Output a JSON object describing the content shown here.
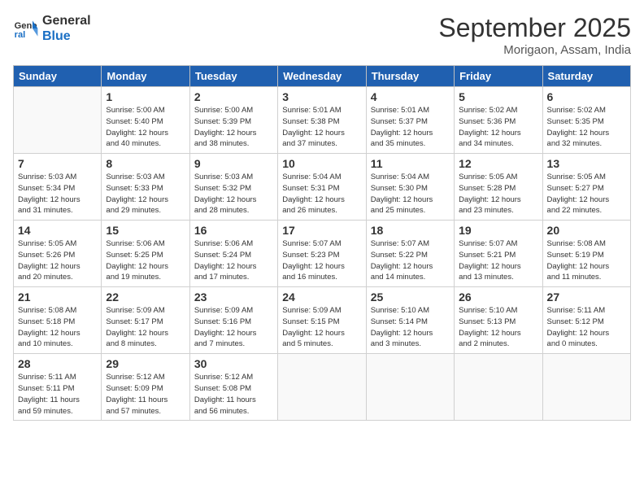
{
  "header": {
    "logo_line1": "General",
    "logo_line2": "Blue",
    "month": "September 2025",
    "location": "Morigaon, Assam, India"
  },
  "days_of_week": [
    "Sunday",
    "Monday",
    "Tuesday",
    "Wednesday",
    "Thursday",
    "Friday",
    "Saturday"
  ],
  "weeks": [
    [
      {
        "day": "",
        "info": ""
      },
      {
        "day": "1",
        "info": "Sunrise: 5:00 AM\nSunset: 5:40 PM\nDaylight: 12 hours\nand 40 minutes."
      },
      {
        "day": "2",
        "info": "Sunrise: 5:00 AM\nSunset: 5:39 PM\nDaylight: 12 hours\nand 38 minutes."
      },
      {
        "day": "3",
        "info": "Sunrise: 5:01 AM\nSunset: 5:38 PM\nDaylight: 12 hours\nand 37 minutes."
      },
      {
        "day": "4",
        "info": "Sunrise: 5:01 AM\nSunset: 5:37 PM\nDaylight: 12 hours\nand 35 minutes."
      },
      {
        "day": "5",
        "info": "Sunrise: 5:02 AM\nSunset: 5:36 PM\nDaylight: 12 hours\nand 34 minutes."
      },
      {
        "day": "6",
        "info": "Sunrise: 5:02 AM\nSunset: 5:35 PM\nDaylight: 12 hours\nand 32 minutes."
      }
    ],
    [
      {
        "day": "7",
        "info": "Sunrise: 5:03 AM\nSunset: 5:34 PM\nDaylight: 12 hours\nand 31 minutes."
      },
      {
        "day": "8",
        "info": "Sunrise: 5:03 AM\nSunset: 5:33 PM\nDaylight: 12 hours\nand 29 minutes."
      },
      {
        "day": "9",
        "info": "Sunrise: 5:03 AM\nSunset: 5:32 PM\nDaylight: 12 hours\nand 28 minutes."
      },
      {
        "day": "10",
        "info": "Sunrise: 5:04 AM\nSunset: 5:31 PM\nDaylight: 12 hours\nand 26 minutes."
      },
      {
        "day": "11",
        "info": "Sunrise: 5:04 AM\nSunset: 5:30 PM\nDaylight: 12 hours\nand 25 minutes."
      },
      {
        "day": "12",
        "info": "Sunrise: 5:05 AM\nSunset: 5:28 PM\nDaylight: 12 hours\nand 23 minutes."
      },
      {
        "day": "13",
        "info": "Sunrise: 5:05 AM\nSunset: 5:27 PM\nDaylight: 12 hours\nand 22 minutes."
      }
    ],
    [
      {
        "day": "14",
        "info": "Sunrise: 5:05 AM\nSunset: 5:26 PM\nDaylight: 12 hours\nand 20 minutes."
      },
      {
        "day": "15",
        "info": "Sunrise: 5:06 AM\nSunset: 5:25 PM\nDaylight: 12 hours\nand 19 minutes."
      },
      {
        "day": "16",
        "info": "Sunrise: 5:06 AM\nSunset: 5:24 PM\nDaylight: 12 hours\nand 17 minutes."
      },
      {
        "day": "17",
        "info": "Sunrise: 5:07 AM\nSunset: 5:23 PM\nDaylight: 12 hours\nand 16 minutes."
      },
      {
        "day": "18",
        "info": "Sunrise: 5:07 AM\nSunset: 5:22 PM\nDaylight: 12 hours\nand 14 minutes."
      },
      {
        "day": "19",
        "info": "Sunrise: 5:07 AM\nSunset: 5:21 PM\nDaylight: 12 hours\nand 13 minutes."
      },
      {
        "day": "20",
        "info": "Sunrise: 5:08 AM\nSunset: 5:19 PM\nDaylight: 12 hours\nand 11 minutes."
      }
    ],
    [
      {
        "day": "21",
        "info": "Sunrise: 5:08 AM\nSunset: 5:18 PM\nDaylight: 12 hours\nand 10 minutes."
      },
      {
        "day": "22",
        "info": "Sunrise: 5:09 AM\nSunset: 5:17 PM\nDaylight: 12 hours\nand 8 minutes."
      },
      {
        "day": "23",
        "info": "Sunrise: 5:09 AM\nSunset: 5:16 PM\nDaylight: 12 hours\nand 7 minutes."
      },
      {
        "day": "24",
        "info": "Sunrise: 5:09 AM\nSunset: 5:15 PM\nDaylight: 12 hours\nand 5 minutes."
      },
      {
        "day": "25",
        "info": "Sunrise: 5:10 AM\nSunset: 5:14 PM\nDaylight: 12 hours\nand 3 minutes."
      },
      {
        "day": "26",
        "info": "Sunrise: 5:10 AM\nSunset: 5:13 PM\nDaylight: 12 hours\nand 2 minutes."
      },
      {
        "day": "27",
        "info": "Sunrise: 5:11 AM\nSunset: 5:12 PM\nDaylight: 12 hours\nand 0 minutes."
      }
    ],
    [
      {
        "day": "28",
        "info": "Sunrise: 5:11 AM\nSunset: 5:11 PM\nDaylight: 11 hours\nand 59 minutes."
      },
      {
        "day": "29",
        "info": "Sunrise: 5:12 AM\nSunset: 5:09 PM\nDaylight: 11 hours\nand 57 minutes."
      },
      {
        "day": "30",
        "info": "Sunrise: 5:12 AM\nSunset: 5:08 PM\nDaylight: 11 hours\nand 56 minutes."
      },
      {
        "day": "",
        "info": ""
      },
      {
        "day": "",
        "info": ""
      },
      {
        "day": "",
        "info": ""
      },
      {
        "day": "",
        "info": ""
      }
    ]
  ]
}
